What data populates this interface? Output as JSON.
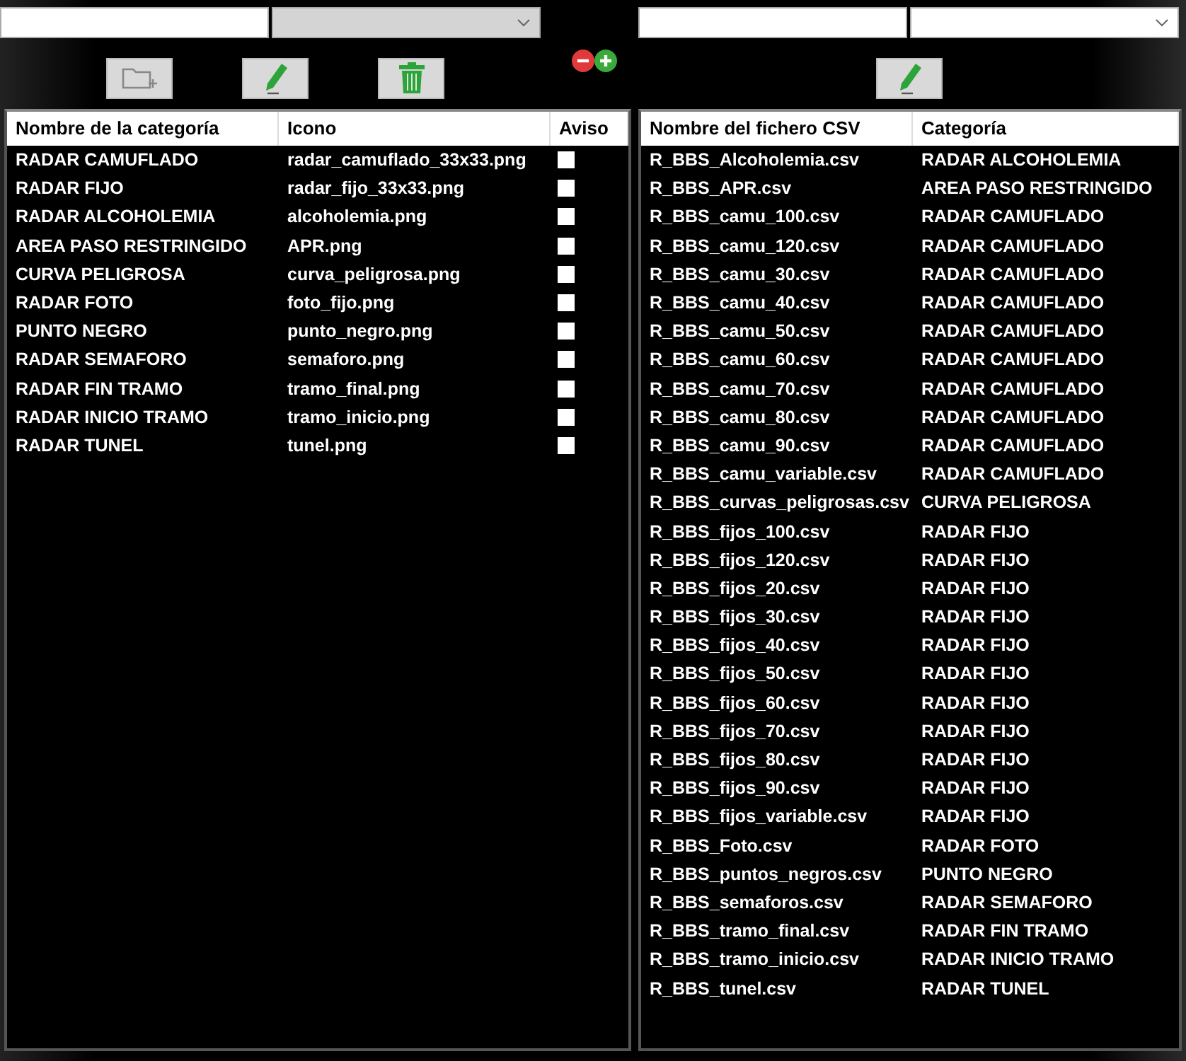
{
  "left": {
    "combo": {
      "disabled": true
    },
    "toolbar": [
      {
        "kind": "new-folder",
        "disabled": true
      },
      {
        "kind": "edit",
        "disabled": false
      },
      {
        "kind": "delete",
        "disabled": false
      }
    ],
    "table": {
      "columns": [
        "Nombre de la categoría",
        "Icono",
        "Aviso"
      ],
      "rows": [
        {
          "name": "RADAR CAMUFLADO",
          "icon": "radar_camuflado_33x33.png",
          "checked": false
        },
        {
          "name": "RADAR FIJO",
          "icon": "radar_fijo_33x33.png",
          "checked": false
        },
        {
          "name": "RADAR ALCOHOLEMIA",
          "icon": "alcoholemia.png",
          "checked": false
        },
        {
          "name": "AREA PASO RESTRINGIDO",
          "icon": "APR.png",
          "checked": false
        },
        {
          "name": "CURVA PELIGROSA",
          "icon": "curva_peligrosa.png",
          "checked": false
        },
        {
          "name": "RADAR FOTO",
          "icon": "foto_fijo.png",
          "checked": false
        },
        {
          "name": "PUNTO NEGRO",
          "icon": "punto_negro.png",
          "checked": false
        },
        {
          "name": "RADAR SEMAFORO",
          "icon": "semaforo.png",
          "checked": false
        },
        {
          "name": "RADAR FIN TRAMO",
          "icon": "tramo_final.png",
          "checked": false
        },
        {
          "name": "RADAR INICIO TRAMO",
          "icon": "tramo_inicio.png",
          "checked": false
        },
        {
          "name": "RADAR TUNEL",
          "icon": "tunel.png",
          "checked": false
        }
      ]
    }
  },
  "right": {
    "combo": {
      "disabled": false
    },
    "toolbar": [
      {
        "kind": "edit",
        "disabled": false
      }
    ],
    "table": {
      "columns": [
        "Nombre del fichero CSV",
        "Categoría"
      ],
      "rows": [
        [
          "R_BBS_Alcoholemia.csv",
          "RADAR ALCOHOLEMIA"
        ],
        [
          "R_BBS_APR.csv",
          "AREA PASO RESTRINGIDO"
        ],
        [
          "R_BBS_camu_100.csv",
          "RADAR CAMUFLADO"
        ],
        [
          "R_BBS_camu_120.csv",
          "RADAR CAMUFLADO"
        ],
        [
          "R_BBS_camu_30.csv",
          "RADAR CAMUFLADO"
        ],
        [
          "R_BBS_camu_40.csv",
          "RADAR CAMUFLADO"
        ],
        [
          "R_BBS_camu_50.csv",
          "RADAR CAMUFLADO"
        ],
        [
          "R_BBS_camu_60.csv",
          "RADAR CAMUFLADO"
        ],
        [
          "R_BBS_camu_70.csv",
          "RADAR CAMUFLADO"
        ],
        [
          "R_BBS_camu_80.csv",
          "RADAR CAMUFLADO"
        ],
        [
          "R_BBS_camu_90.csv",
          "RADAR CAMUFLADO"
        ],
        [
          "R_BBS_camu_variable.csv",
          "RADAR CAMUFLADO"
        ],
        [
          "R_BBS_curvas_peligrosas.csv",
          "CURVA PELIGROSA"
        ],
        [
          "R_BBS_fijos_100.csv",
          "RADAR FIJO"
        ],
        [
          "R_BBS_fijos_120.csv",
          "RADAR FIJO"
        ],
        [
          "R_BBS_fijos_20.csv",
          "RADAR FIJO"
        ],
        [
          "R_BBS_fijos_30.csv",
          "RADAR FIJO"
        ],
        [
          "R_BBS_fijos_40.csv",
          "RADAR FIJO"
        ],
        [
          "R_BBS_fijos_50.csv",
          "RADAR FIJO"
        ],
        [
          "R_BBS_fijos_60.csv",
          "RADAR FIJO"
        ],
        [
          "R_BBS_fijos_70.csv",
          "RADAR FIJO"
        ],
        [
          "R_BBS_fijos_80.csv",
          "RADAR FIJO"
        ],
        [
          "R_BBS_fijos_90.csv",
          "RADAR FIJO"
        ],
        [
          "R_BBS_fijos_variable.csv",
          "RADAR FIJO"
        ],
        [
          "R_BBS_Foto.csv",
          "RADAR FOTO"
        ],
        [
          "R_BBS_puntos_negros.csv",
          "PUNTO NEGRO"
        ],
        [
          "R_BBS_semaforos.csv",
          "RADAR SEMAFORO"
        ],
        [
          "R_BBS_tramo_final.csv",
          "RADAR FIN TRAMO"
        ],
        [
          "R_BBS_tramo_inicio.csv",
          "RADAR INICIO TRAMO"
        ],
        [
          "R_BBS_tunel.csv",
          "RADAR TUNEL"
        ]
      ]
    }
  }
}
